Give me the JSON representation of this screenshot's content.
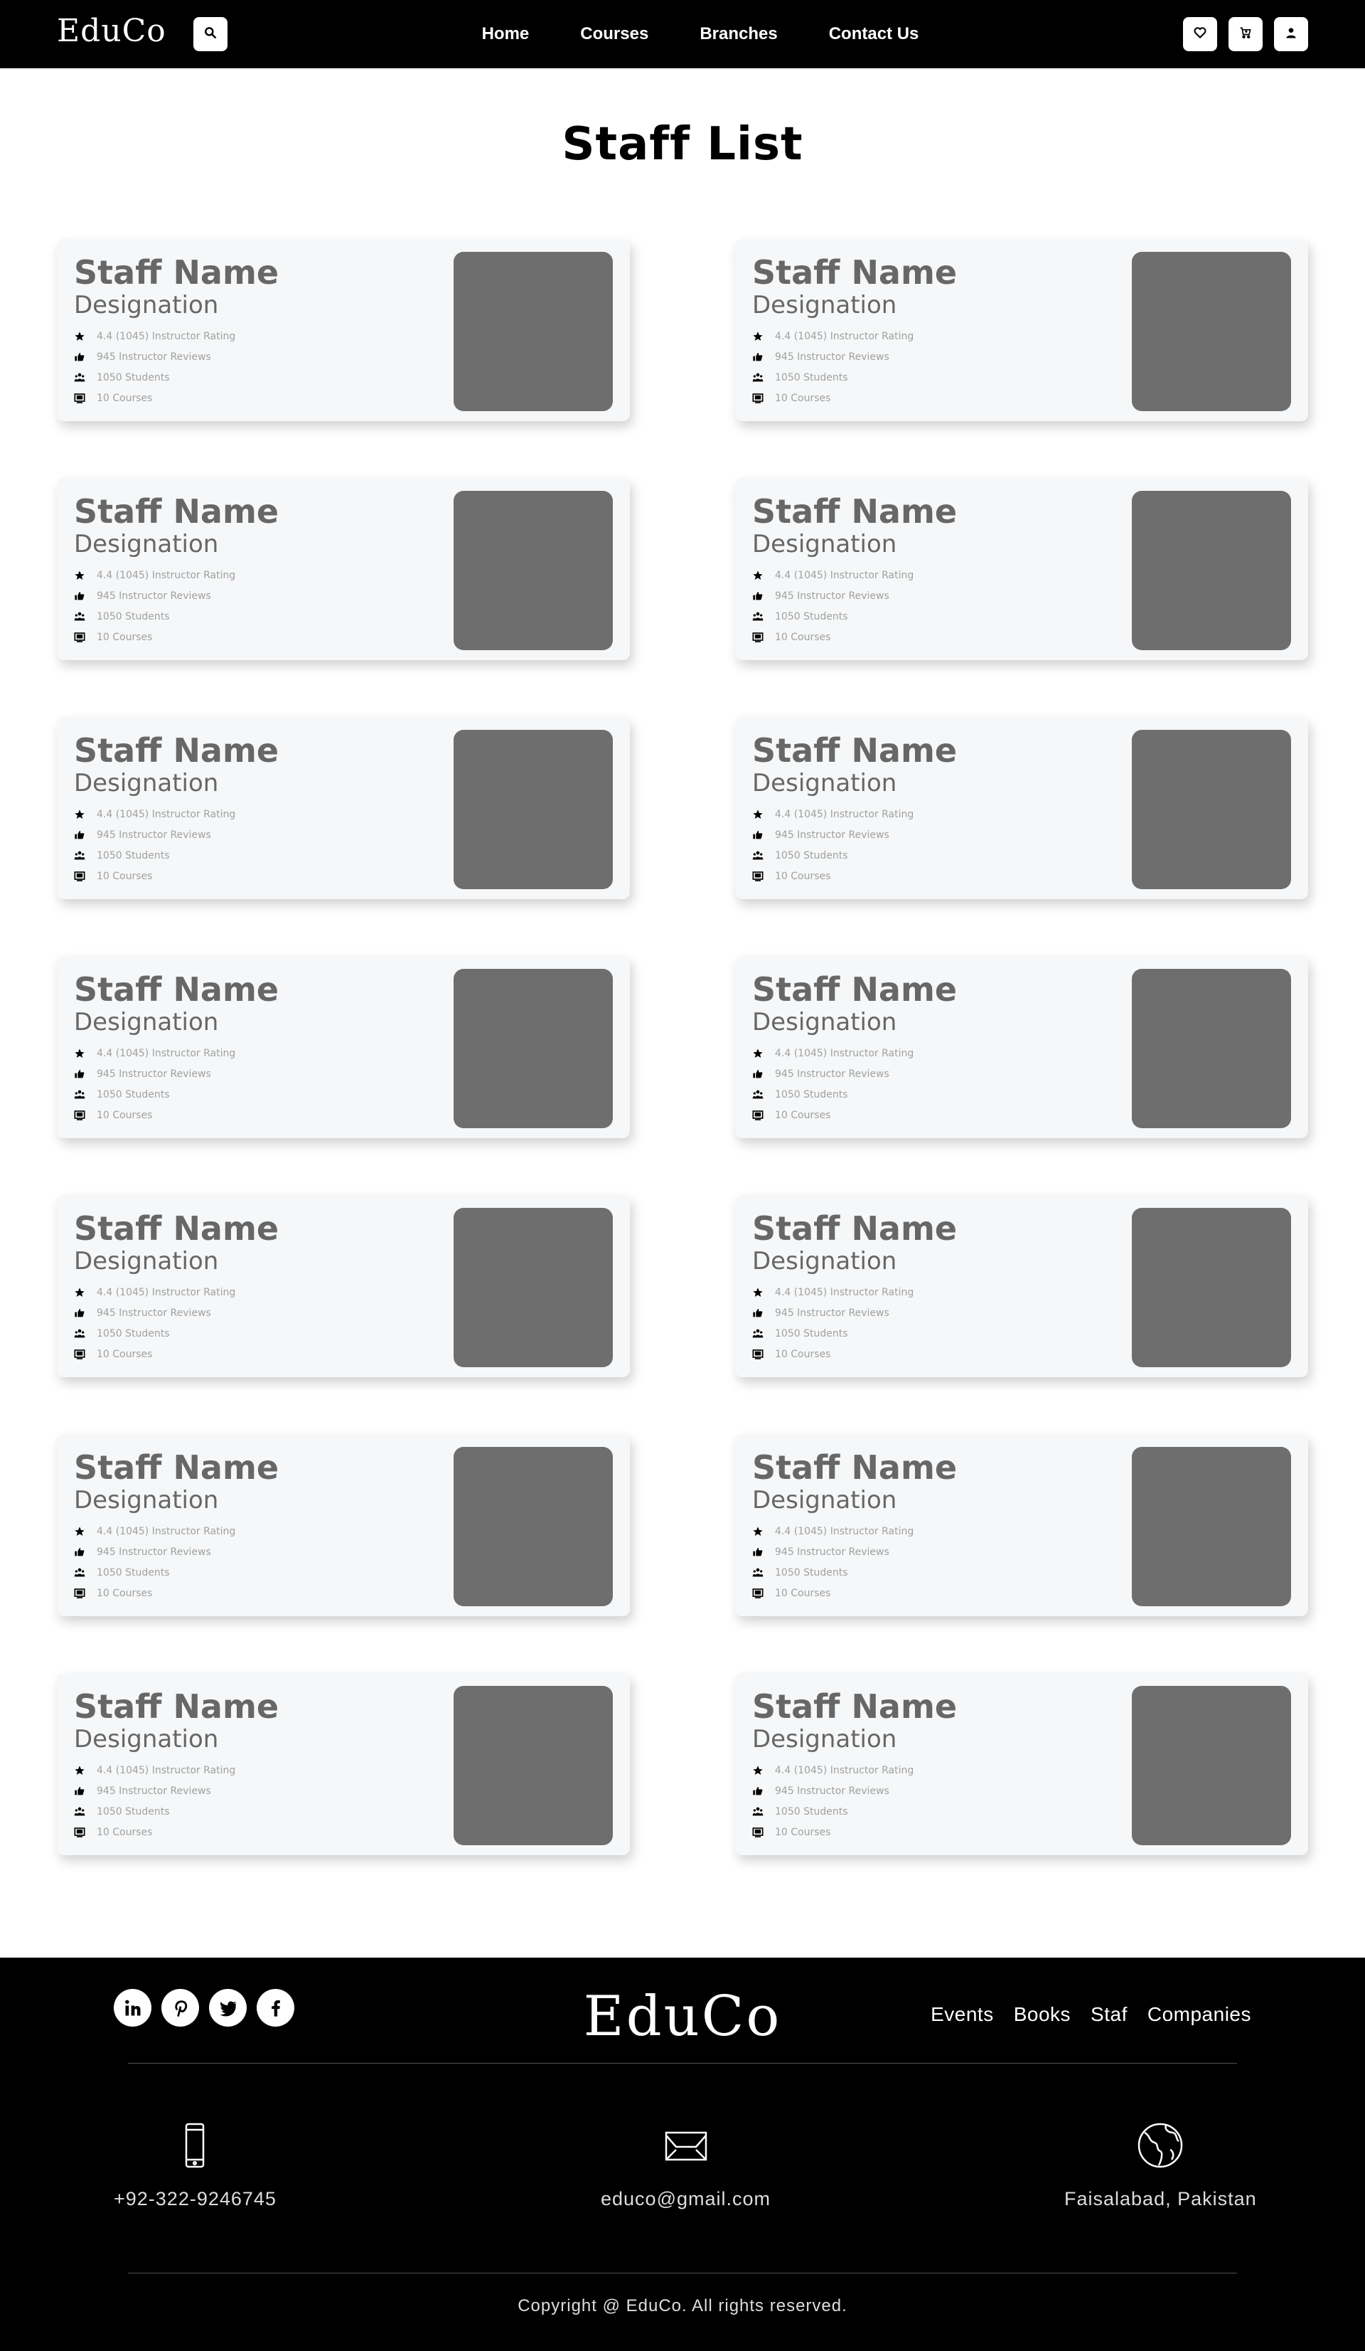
{
  "header": {
    "logo": "EduCo",
    "search_icon": "search-icon",
    "nav": [
      "Home",
      "Courses",
      "Branches",
      "Contact Us"
    ],
    "icons": [
      "heart-icon",
      "cart-icon",
      "user-icon"
    ]
  },
  "page_title": "Staff List",
  "staff": [
    {
      "name": "Staff Name",
      "designation": "Designation",
      "rating": "4.4 (1045) Instructor Rating",
      "reviews": "945 Instructor Reviews",
      "students": "1050 Students",
      "courses": "10 Courses"
    },
    {
      "name": "Staff Name",
      "designation": "Designation",
      "rating": "4.4 (1045) Instructor Rating",
      "reviews": "945 Instructor Reviews",
      "students": "1050 Students",
      "courses": "10 Courses"
    },
    {
      "name": "Staff Name",
      "designation": "Designation",
      "rating": "4.4 (1045) Instructor Rating",
      "reviews": "945 Instructor Reviews",
      "students": "1050 Students",
      "courses": "10 Courses"
    },
    {
      "name": "Staff Name",
      "designation": "Designation",
      "rating": "4.4 (1045) Instructor Rating",
      "reviews": "945 Instructor Reviews",
      "students": "1050 Students",
      "courses": "10 Courses"
    },
    {
      "name": "Staff Name",
      "designation": "Designation",
      "rating": "4.4 (1045) Instructor Rating",
      "reviews": "945 Instructor Reviews",
      "students": "1050 Students",
      "courses": "10 Courses"
    },
    {
      "name": "Staff Name",
      "designation": "Designation",
      "rating": "4.4 (1045) Instructor Rating",
      "reviews": "945 Instructor Reviews",
      "students": "1050 Students",
      "courses": "10 Courses"
    },
    {
      "name": "Staff Name",
      "designation": "Designation",
      "rating": "4.4 (1045) Instructor Rating",
      "reviews": "945 Instructor Reviews",
      "students": "1050 Students",
      "courses": "10 Courses"
    },
    {
      "name": "Staff Name",
      "designation": "Designation",
      "rating": "4.4 (1045) Instructor Rating",
      "reviews": "945 Instructor Reviews",
      "students": "1050 Students",
      "courses": "10 Courses"
    },
    {
      "name": "Staff Name",
      "designation": "Designation",
      "rating": "4.4 (1045) Instructor Rating",
      "reviews": "945 Instructor Reviews",
      "students": "1050 Students",
      "courses": "10 Courses"
    },
    {
      "name": "Staff Name",
      "designation": "Designation",
      "rating": "4.4 (1045) Instructor Rating",
      "reviews": "945 Instructor Reviews",
      "students": "1050 Students",
      "courses": "10 Courses"
    },
    {
      "name": "Staff Name",
      "designation": "Designation",
      "rating": "4.4 (1045) Instructor Rating",
      "reviews": "945 Instructor Reviews",
      "students": "1050 Students",
      "courses": "10 Courses"
    },
    {
      "name": "Staff Name",
      "designation": "Designation",
      "rating": "4.4 (1045) Instructor Rating",
      "reviews": "945 Instructor Reviews",
      "students": "1050 Students",
      "courses": "10 Courses"
    },
    {
      "name": "Staff Name",
      "designation": "Designation",
      "rating": "4.4 (1045) Instructor Rating",
      "reviews": "945 Instructor Reviews",
      "students": "1050 Students",
      "courses": "10 Courses"
    },
    {
      "name": "Staff Name",
      "designation": "Designation",
      "rating": "4.4 (1045) Instructor Rating",
      "reviews": "945 Instructor Reviews",
      "students": "1050 Students",
      "courses": "10 Courses"
    }
  ],
  "footer": {
    "logo": "EduCo",
    "social": [
      "linkedin-icon",
      "pinterest-icon",
      "twitter-icon",
      "facebook-icon"
    ],
    "links": [
      "Events",
      "Books",
      "Staf",
      "Companies"
    ],
    "contact": {
      "phone": "+92-322-9246745",
      "email": "educo@gmail.com",
      "location": "Faisalabad, Pakistan"
    },
    "copyright": "Copyright @ EduCo. All rights reserved."
  }
}
